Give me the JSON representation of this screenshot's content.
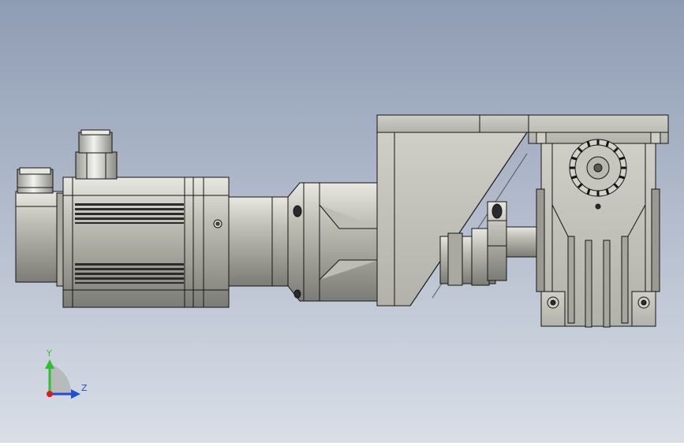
{
  "viewport": {
    "background_top": "#8e9cb3",
    "background_bottom": "#d9dee7"
  },
  "part_colors": {
    "body": "#bdbdb4",
    "body_dark": "#8d8d86",
    "edge": "#141414",
    "slot": "#2b2b2b",
    "connector": "#d6d6d0"
  },
  "triad": {
    "y_label": "Y",
    "z_label": "Z",
    "y_color": "#2fbf2f",
    "z_color": "#1e4fd8",
    "x_color": "#d81e1e"
  }
}
